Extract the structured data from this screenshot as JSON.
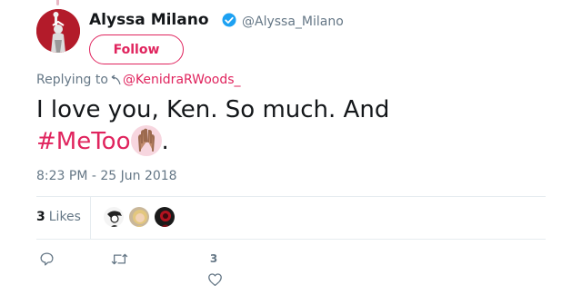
{
  "tweet": {
    "author": {
      "name": "Alyssa Milano",
      "handle": "@Alyssa_Milano",
      "verified": true,
      "avatar_icon": "statue-of-liberty-avatar"
    },
    "follow_label": "Follow",
    "replying_to_label": "Replying to",
    "replying_to_handle": "@KenidraRWoods_",
    "text": "I love you, Ken. So much. And",
    "hashtag": "#MeToo",
    "emoji_icon": "raised-hands-emoji",
    "trailing": ".",
    "timestamp": "8:23 PM - 25 Jun 2018"
  },
  "stats": {
    "like_count": "3",
    "like_label": "Likes",
    "liker_avatars": [
      "person-sketch-avatar",
      "blonde-woman-avatar",
      "red-floral-avatar"
    ]
  },
  "actions": {
    "reply_icon": "reply-icon",
    "retweet_icon": "retweet-icon",
    "like_icon": "heart-icon",
    "like_count": "3"
  },
  "colors": {
    "accent": "#e0245e",
    "secondary_text": "#657786",
    "verified": "#1da1f2",
    "divider": "#e6ecf0"
  }
}
